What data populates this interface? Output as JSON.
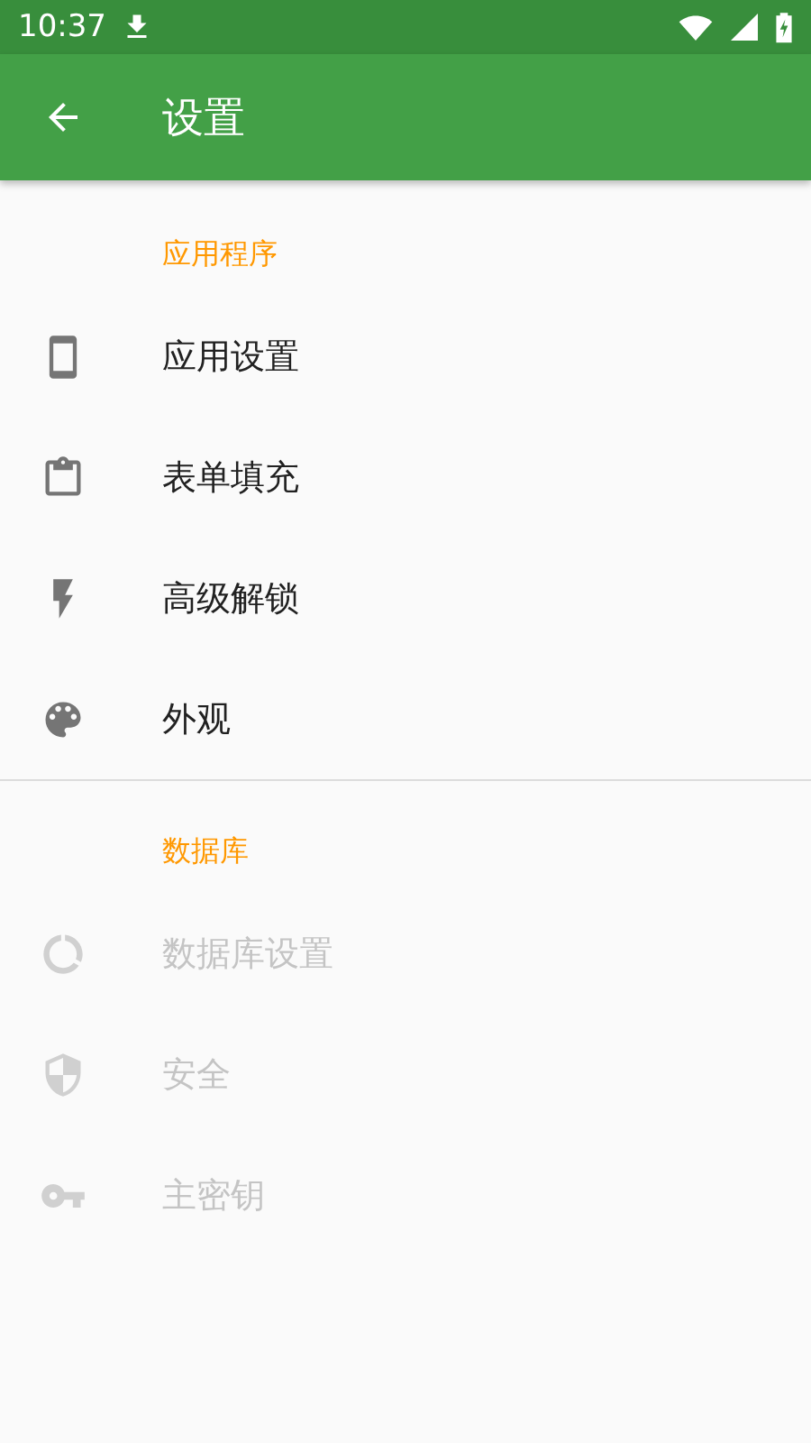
{
  "status_bar": {
    "time": "10:37"
  },
  "app_bar": {
    "title": "设置"
  },
  "sections": [
    {
      "title": "应用程序",
      "items": [
        {
          "label": "应用设置",
          "disabled": false
        },
        {
          "label": "表单填充",
          "disabled": false
        },
        {
          "label": "高级解锁",
          "disabled": false
        },
        {
          "label": "外观",
          "disabled": false
        }
      ]
    },
    {
      "title": "数据库",
      "items": [
        {
          "label": "数据库设置",
          "disabled": true
        },
        {
          "label": "安全",
          "disabled": true
        },
        {
          "label": "主密钥",
          "disabled": true
        }
      ]
    }
  ]
}
